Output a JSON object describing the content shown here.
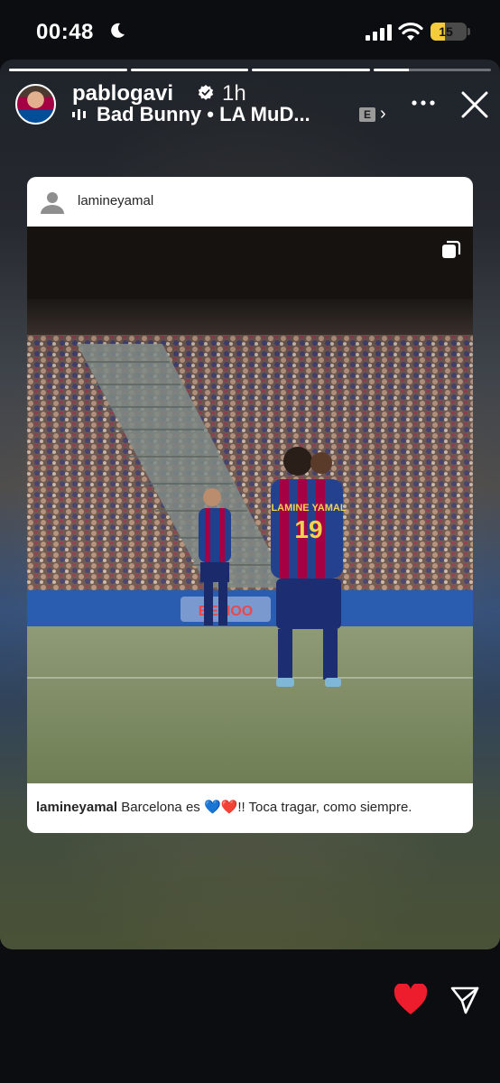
{
  "status_bar": {
    "time": "00:48",
    "battery_level": "15"
  },
  "story": {
    "progress_segments": [
      1,
      1,
      1,
      0.3
    ],
    "username": "pablogavi",
    "time_ago": "1h",
    "music": {
      "artist": "Bad Bunny",
      "title": "LA MuD...",
      "explicit_label": "E"
    }
  },
  "shared_post": {
    "username": "lamineyamal",
    "caption_username": "lamineyamal",
    "caption_part1": "Barcelona es",
    "caption_emojis": "💙❤️",
    "caption_part2": "!! Toca tragar, como siempre.",
    "photo_texts": {
      "jersey_name": "LAMINE YAMAL",
      "jersey_number": "19",
      "board_text": "BEMOO"
    }
  },
  "colors": {
    "like": "#ee1d2d",
    "barca_blue": "#004d98",
    "barca_red": "#a50044",
    "battery": "#f4cc3a"
  },
  "icons": [
    "moon-icon",
    "signal-icon",
    "wifi-icon",
    "verified-icon",
    "music-icon",
    "more-icon",
    "close-icon",
    "carousel-icon",
    "heart-icon",
    "send-icon"
  ]
}
